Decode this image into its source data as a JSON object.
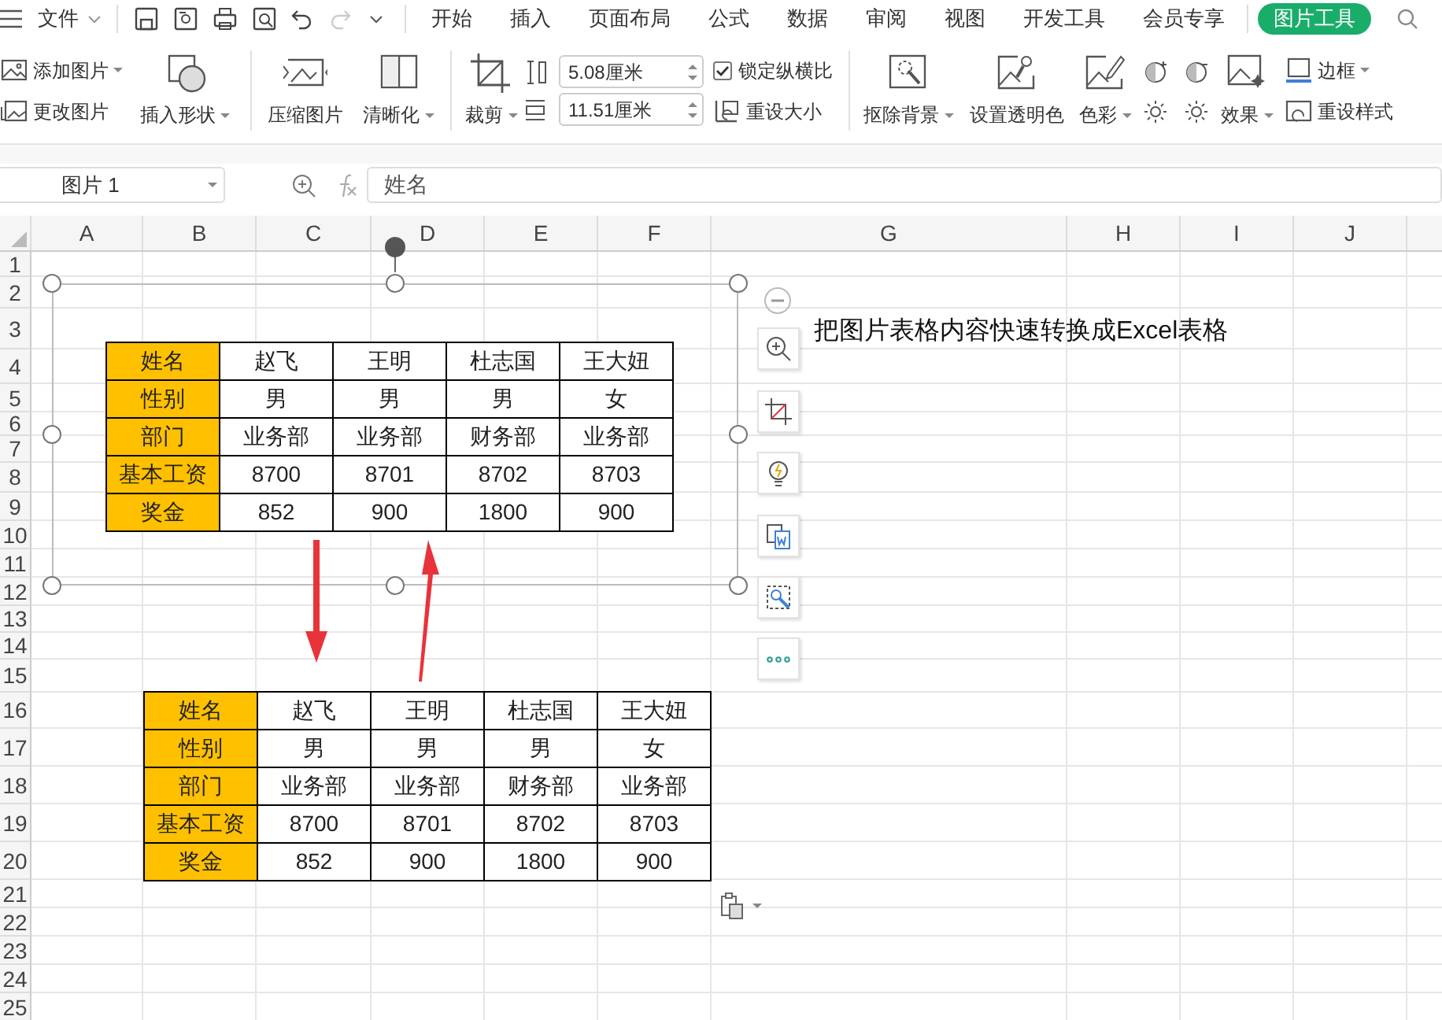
{
  "menu_bar": {
    "file_menu": {
      "label": "文件"
    },
    "quick_access": {
      "undo_disabled": false,
      "redo_disabled": true
    },
    "tabs": [
      {
        "label": "开始",
        "selected": false
      },
      {
        "label": "插入",
        "selected": false
      },
      {
        "label": "页面布局",
        "selected": false
      },
      {
        "label": "公式",
        "selected": false
      },
      {
        "label": "数据",
        "selected": false
      },
      {
        "label": "审阅",
        "selected": false
      },
      {
        "label": "视图",
        "selected": false
      },
      {
        "label": "开发工具",
        "selected": false
      },
      {
        "label": "会员专享",
        "selected": false
      },
      {
        "label": "图片工具",
        "selected": true
      }
    ]
  },
  "ribbon": [
    {
      "kind": "stack",
      "items": [
        {
          "kind": "button",
          "label": "添加图片",
          "dropdown": true
        },
        {
          "kind": "button",
          "label": "更改图片",
          "dropdown": false
        }
      ]
    },
    {
      "kind": "large",
      "label": "插入形状",
      "dropdown": true
    },
    {
      "kind": "separator"
    },
    {
      "kind": "large",
      "label": "压缩图片",
      "dropdown": false
    },
    {
      "kind": "large",
      "label": "清晰化",
      "dropdown": true
    },
    {
      "kind": "separator"
    },
    {
      "kind": "large",
      "label": "裁剪",
      "dropdown": true
    },
    {
      "kind": "size",
      "fields": [
        {
          "value": "5.08厘米"
        },
        {
          "value": "11.51厘米"
        }
      ]
    },
    {
      "kind": "stack",
      "items": [
        {
          "kind": "checkbox",
          "label": "锁定纵横比",
          "checked": true
        },
        {
          "kind": "button",
          "label": "重设大小",
          "dropdown": false
        }
      ]
    },
    {
      "kind": "separator"
    },
    {
      "kind": "large",
      "label": "抠除背景",
      "dropdown": true
    },
    {
      "kind": "large",
      "label": "设置透明色",
      "dropdown": false
    },
    {
      "kind": "large",
      "label": "色彩",
      "dropdown": true
    },
    {
      "kind": "adjust"
    },
    {
      "kind": "large",
      "label": "效果",
      "dropdown": true
    },
    {
      "kind": "stack",
      "items": [
        {
          "kind": "button",
          "label": "边框",
          "dropdown": true
        },
        {
          "kind": "button",
          "label": "重设样式",
          "dropdown": false
        }
      ]
    }
  ],
  "formula_bar": {
    "name_box": "图片 1",
    "formula": "姓名"
  },
  "sheet": {
    "columns": [
      "A",
      "B",
      "C",
      "D",
      "E",
      "F",
      "G",
      "H",
      "I",
      "J"
    ],
    "rows": [
      "1",
      "2",
      "3",
      "4",
      "5",
      "6",
      "7",
      "8",
      "9",
      "10",
      "11",
      "12",
      "13",
      "14",
      "15",
      "16",
      "17",
      "18",
      "19",
      "20",
      "21",
      "22",
      "23",
      "24",
      "25"
    ]
  },
  "tables": [
    {
      "rows": [
        {
          "header": "姓名",
          "cells": [
            "赵飞",
            "王明",
            "杜志国",
            "王大妞"
          ]
        },
        {
          "header": "性别",
          "cells": [
            "男",
            "男",
            "男",
            "女"
          ]
        },
        {
          "header": "部门",
          "cells": [
            "业务部",
            "业务部",
            "财务部",
            "业务部"
          ]
        },
        {
          "header": "基本工资",
          "cells": [
            "8700",
            "8701",
            "8702",
            "8703"
          ]
        },
        {
          "header": "奖金",
          "cells": [
            "852",
            "900",
            "1800",
            "900"
          ]
        }
      ]
    },
    {
      "rows": [
        {
          "header": "姓名",
          "cells": [
            "赵飞",
            "王明",
            "杜志国",
            "王大妞"
          ]
        },
        {
          "header": "性别",
          "cells": [
            "男",
            "男",
            "男",
            "女"
          ]
        },
        {
          "header": "部门",
          "cells": [
            "业务部",
            "业务部",
            "财务部",
            "业务部"
          ]
        },
        {
          "header": "基本工资",
          "cells": [
            "8700",
            "8701",
            "8702",
            "8703"
          ]
        },
        {
          "header": "奖金",
          "cells": [
            "852",
            "900",
            "1800",
            "900"
          ]
        }
      ]
    }
  ],
  "caption": "把图片表格内容快速转换成Excel表格"
}
